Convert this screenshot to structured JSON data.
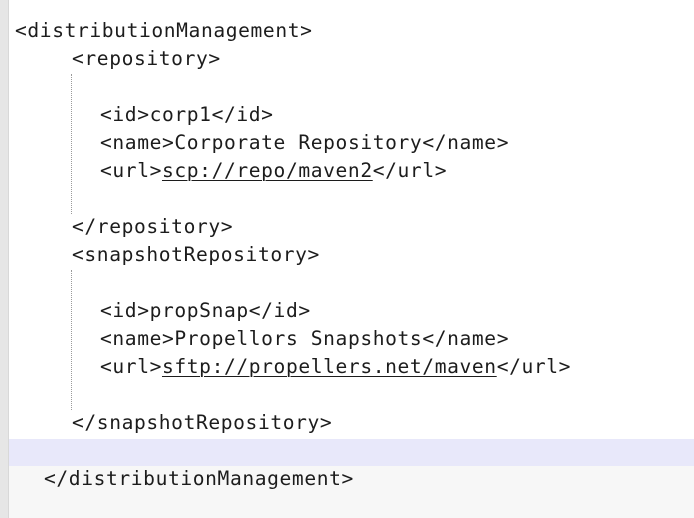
{
  "code_lines": {
    "l1": "<distributionManagement>",
    "l2": "<repository>",
    "l3_open": "<id>",
    "l3_val": "corp1",
    "l3_close": "</id>",
    "l4_open": "<name>",
    "l4_val": "Corporate Repository",
    "l4_close": "</name>",
    "l5_open": "<url>",
    "l5_val": "scp://repo/maven2",
    "l5_close": "</url>",
    "l6": "</repository>",
    "l7": "<snapshotRepository>",
    "l8_open": "<id>",
    "l8_val": "propSnap",
    "l8_close": "</id>",
    "l9_open": "<name>",
    "l9_val": "Propellors Snapshots",
    "l9_close": "</name>",
    "l10_open": "<url>",
    "l10_val": "sftp://propellers.net/maven",
    "l10_close": "</url>",
    "l11": "</snapshotRepository>",
    "l12": "</distributionManagement>"
  },
  "colors": {
    "text": "#1c1c1c",
    "background": "#ffffff",
    "current_line_highlight": "#e8e8fa",
    "gutter": "#e6e6e6"
  }
}
